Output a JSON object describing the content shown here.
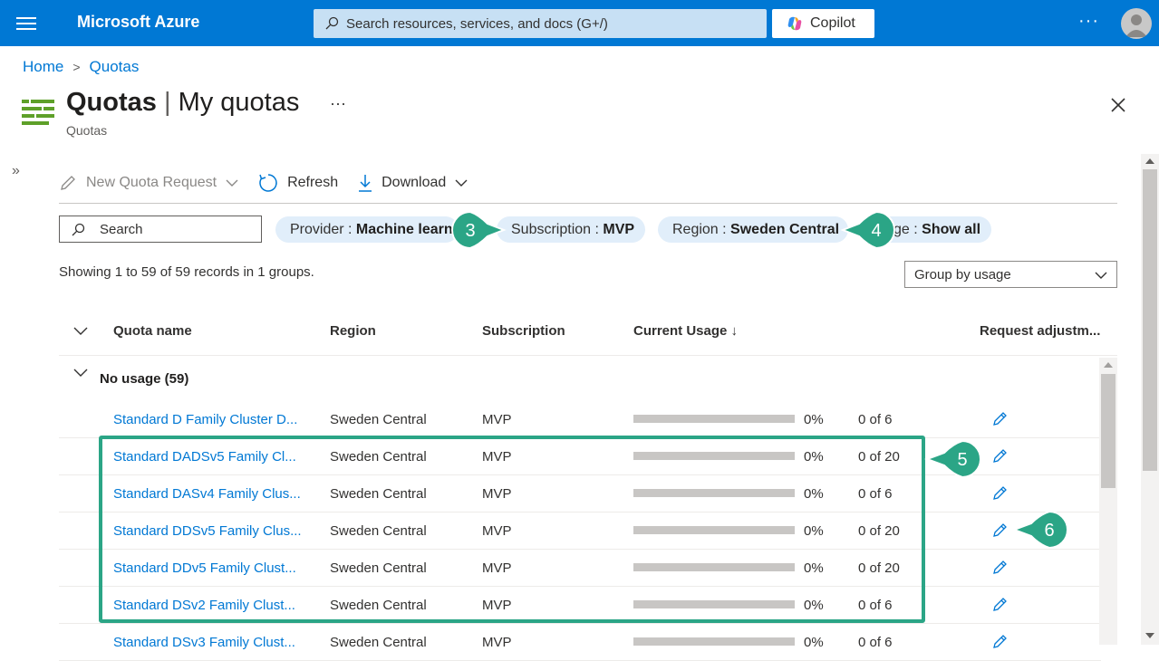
{
  "topbar": {
    "brand": "Microsoft Azure",
    "search_placeholder": "Search resources, services, and docs (G+/)",
    "copilot_label": "Copilot",
    "more": "···"
  },
  "breadcrumb": {
    "home": "Home",
    "current": "Quotas"
  },
  "page": {
    "title_main": "Quotas",
    "title_sep": "|",
    "title_sub": "My quotas",
    "dots": "···",
    "subtitle": "Quotas"
  },
  "toolbar": {
    "new_request": "New Quota Request",
    "refresh": "Refresh",
    "download": "Download"
  },
  "filters": {
    "search_placeholder": "Search",
    "provider_key": "Provider : ",
    "provider_val": "Machine learn",
    "subscription_key": "Subscription : ",
    "subscription_val": "MVP",
    "region_key": "Region : ",
    "region_val": "Sweden Central",
    "usage_key": "ge : ",
    "usage_val": "Show all"
  },
  "records_text": "Showing 1 to 59 of 59 records in 1 groups.",
  "group_by": "Group by usage",
  "columns": {
    "name": "Quota name",
    "region": "Region",
    "subscription": "Subscription",
    "usage": "Current Usage ↓",
    "request": "Request adjustm..."
  },
  "group_label": "No usage (59)",
  "rows": [
    {
      "name": "Standard D Family Cluster D...",
      "region": "Sweden Central",
      "sub": "MVP",
      "pct": "0%",
      "usage": "0 of 6"
    },
    {
      "name": "Standard DADSv5 Family Cl...",
      "region": "Sweden Central",
      "sub": "MVP",
      "pct": "0%",
      "usage": "0 of 20"
    },
    {
      "name": "Standard DASv4 Family Clus...",
      "region": "Sweden Central",
      "sub": "MVP",
      "pct": "0%",
      "usage": "0 of 6"
    },
    {
      "name": "Standard DDSv5 Family Clus...",
      "region": "Sweden Central",
      "sub": "MVP",
      "pct": "0%",
      "usage": "0 of 20"
    },
    {
      "name": "Standard DDv5 Family Clust...",
      "region": "Sweden Central",
      "sub": "MVP",
      "pct": "0%",
      "usage": "0 of 20"
    },
    {
      "name": "Standard DSv2 Family Clust...",
      "region": "Sweden Central",
      "sub": "MVP",
      "pct": "0%",
      "usage": "0 of 6"
    },
    {
      "name": "Standard DSv3 Family Clust...",
      "region": "Sweden Central",
      "sub": "MVP",
      "pct": "0%",
      "usage": "0 of 6"
    }
  ],
  "callouts": {
    "c3": "3",
    "c4": "4",
    "c5": "5",
    "c6": "6"
  },
  "colors": {
    "accent": "#0078d4",
    "callout": "#2ba586"
  }
}
